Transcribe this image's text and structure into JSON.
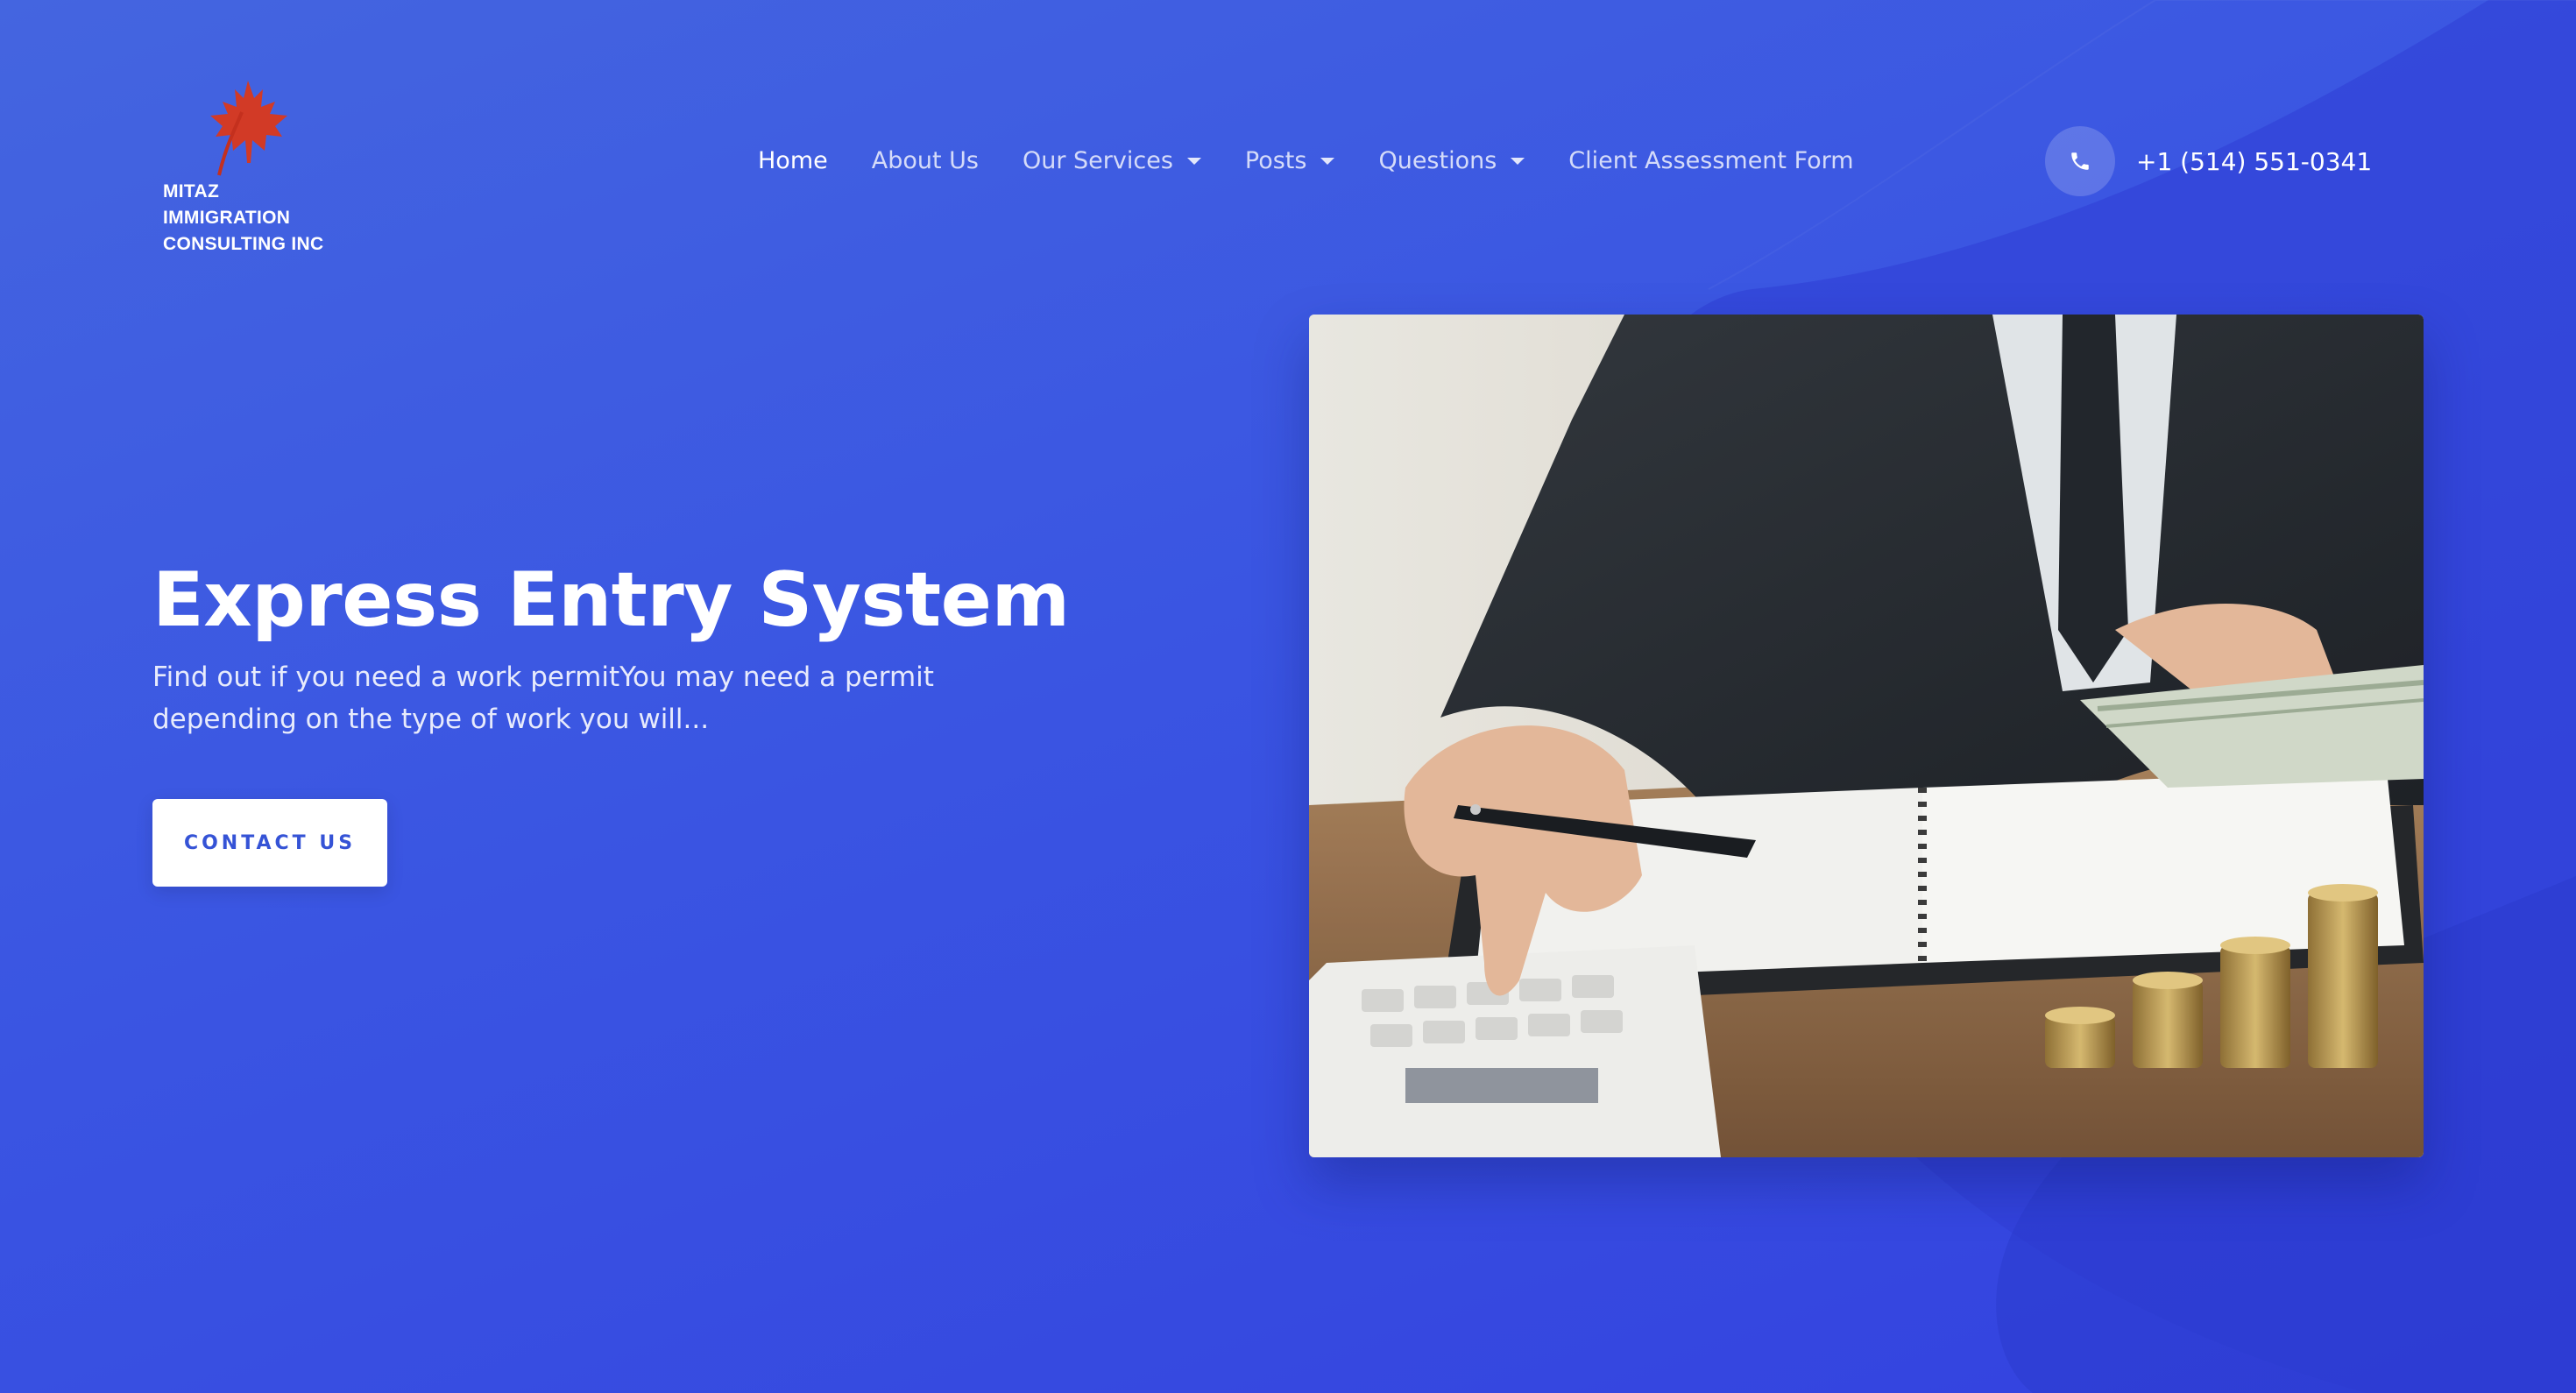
{
  "brand": {
    "lines": [
      "MITAZ",
      "IMMIGRATION",
      "CONSULTING INC"
    ],
    "logo_icon": "maple-leaf-icon",
    "accent": "#d23a26"
  },
  "nav": {
    "items": [
      {
        "label": "Home",
        "active": true,
        "dropdown": false
      },
      {
        "label": "About Us",
        "active": false,
        "dropdown": false
      },
      {
        "label": "Our Services",
        "active": false,
        "dropdown": true
      },
      {
        "label": "Posts",
        "active": false,
        "dropdown": true
      },
      {
        "label": "Questions",
        "active": false,
        "dropdown": true
      },
      {
        "label": "Client Assessment Form",
        "active": false,
        "dropdown": false
      }
    ]
  },
  "contact": {
    "phone_icon": "phone-icon",
    "phone": "+1 (514) 551-0341"
  },
  "hero": {
    "title": "Express Entry System",
    "description": "Find out if you need a work permitYou may need a permit depending on the type of work you will...",
    "cta_label": "CONTACT US",
    "image_subject": "businessman-calculator-coins-photo"
  },
  "colors": {
    "background_start": "#4465e0",
    "background_end": "#3341df",
    "cta_text": "#3553d6"
  }
}
